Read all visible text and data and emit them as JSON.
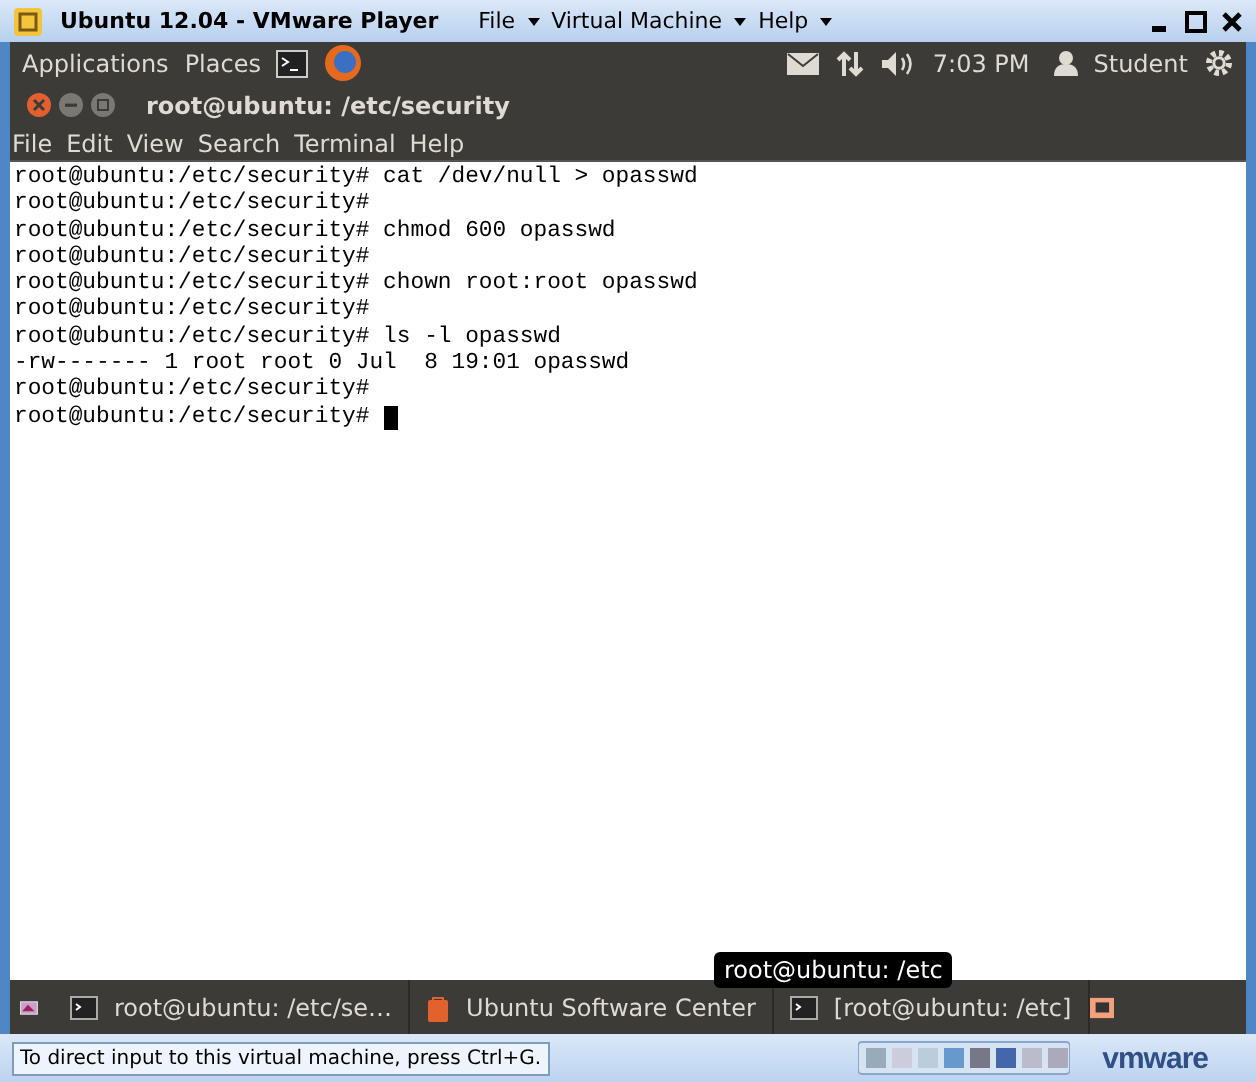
{
  "vmware": {
    "title": "Ubuntu 12.04 - VMware Player",
    "menus": [
      "File",
      "Virtual Machine",
      "Help"
    ]
  },
  "panel": {
    "menus": [
      "Applications",
      "Places"
    ],
    "clock": "7:03 PM",
    "user": "Student"
  },
  "terminal": {
    "title": "root@ubuntu: /etc/security",
    "menus": [
      "File",
      "Edit",
      "View",
      "Search",
      "Terminal",
      "Help"
    ],
    "lines": [
      "root@ubuntu:/etc/security# cat /dev/null > opasswd",
      "root@ubuntu:/etc/security#",
      "root@ubuntu:/etc/security# chmod 600 opasswd",
      "root@ubuntu:/etc/security#",
      "root@ubuntu:/etc/security# chown root:root opasswd",
      "root@ubuntu:/etc/security#",
      "root@ubuntu:/etc/security# ls -l opasswd",
      "-rw------- 1 root root 0 Jul  8 19:01 opasswd",
      "root@ubuntu:/etc/security#",
      "root@ubuntu:/etc/security# "
    ]
  },
  "tooltip": "root@ubuntu: /etc",
  "taskbar": {
    "items": [
      {
        "label": "root@ubuntu: /etc/se…",
        "kind": "terminal"
      },
      {
        "label": "Ubuntu Software Center",
        "kind": "software"
      },
      {
        "label": "[root@ubuntu: /etc]",
        "kind": "terminal"
      }
    ]
  },
  "status_bar": {
    "hint": "To direct input to this virtual machine, press Ctrl+G.",
    "brand": "vmware"
  }
}
